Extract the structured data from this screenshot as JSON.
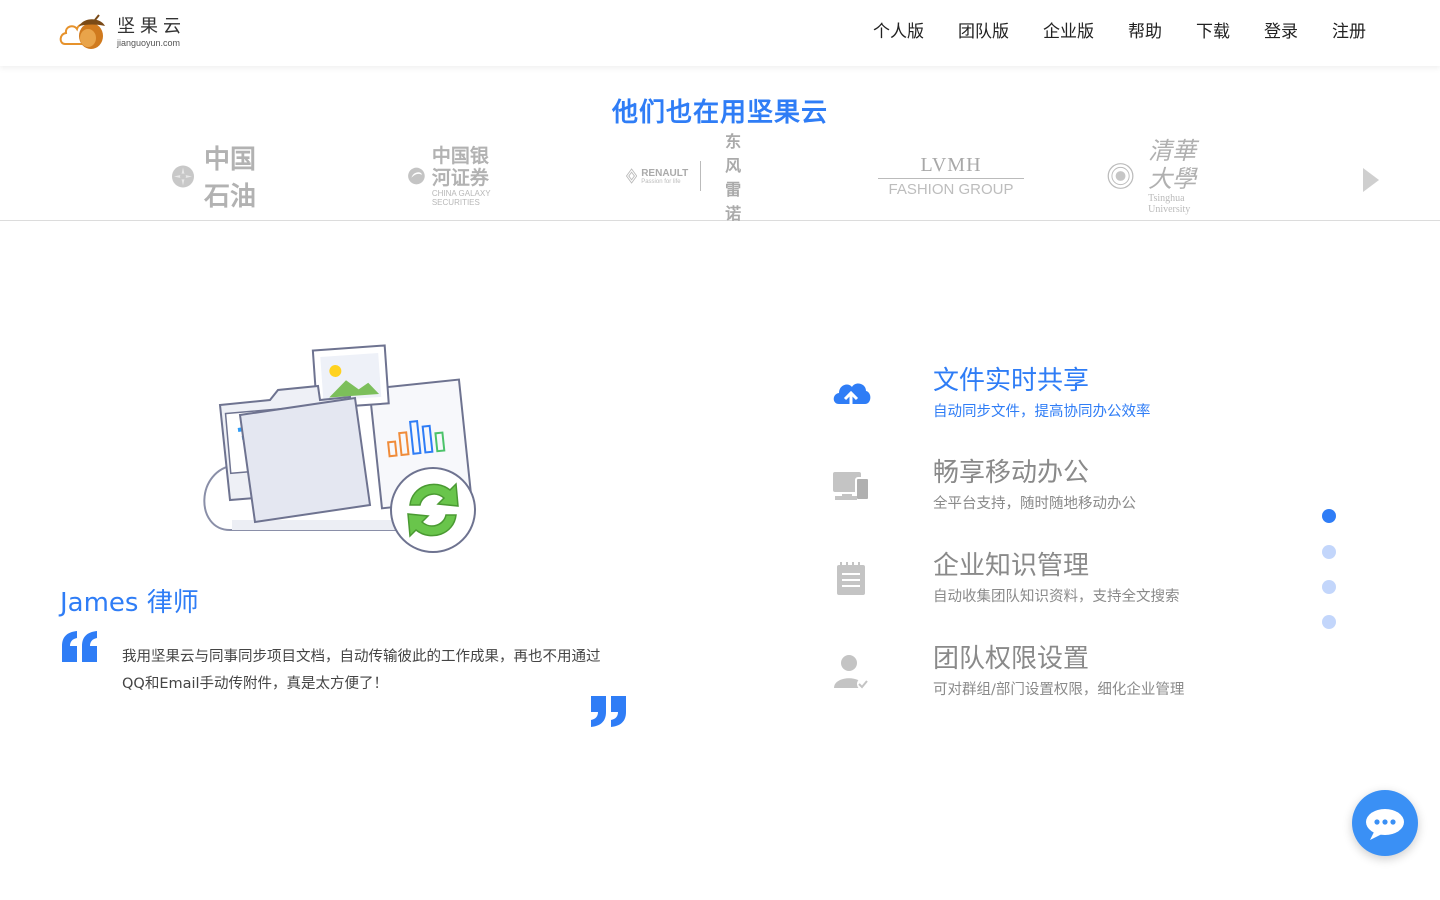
{
  "header": {
    "logo": {
      "name": "坚果云",
      "domain": "jianguoyun.com"
    },
    "nav": [
      "个人版",
      "团队版",
      "企业版",
      "帮助",
      "下载",
      "登录",
      "注册"
    ]
  },
  "clients": {
    "title": "他们也在用坚果云",
    "logos": [
      {
        "name": "中国石油"
      },
      {
        "name": "中国银河证券",
        "sub": "CHINA GALAXY SECURITIES"
      },
      {
        "name": "RENAULT",
        "sub": "Passion for life",
        "cn": "东风雷诺"
      },
      {
        "name": "LVMH",
        "sub": "FASHION GROUP"
      },
      {
        "name": "清華大學",
        "sub": "Tsinghua University"
      }
    ]
  },
  "testimonial": {
    "author": "James 律师",
    "quote": "我用坚果云与同事同步项目文档，自动传输彼此的工作成果，再也不用通过QQ和Email手动传附件，真是太方便了！"
  },
  "features": [
    {
      "title": "文件实时共享",
      "desc": "自动同步文件，提高协同办公效率",
      "icon": "cloud-upload-icon",
      "active": true
    },
    {
      "title": "畅享移动办公",
      "desc": "全平台支持，随时随地移动办公",
      "icon": "devices-icon",
      "active": false
    },
    {
      "title": "企业知识管理",
      "desc": "自动收集团队知识资料，支持全文搜索",
      "icon": "notepad-icon",
      "active": false
    },
    {
      "title": "团队权限设置",
      "desc": "可对群组/部门设置权限，细化企业管理",
      "icon": "user-permission-icon",
      "active": false
    }
  ],
  "pagination": {
    "total": 4,
    "active_index": 0
  },
  "colors": {
    "accent": "#2f7df6",
    "muted": "#8a8a8a",
    "dot_inactive": "#c3d6fb"
  }
}
